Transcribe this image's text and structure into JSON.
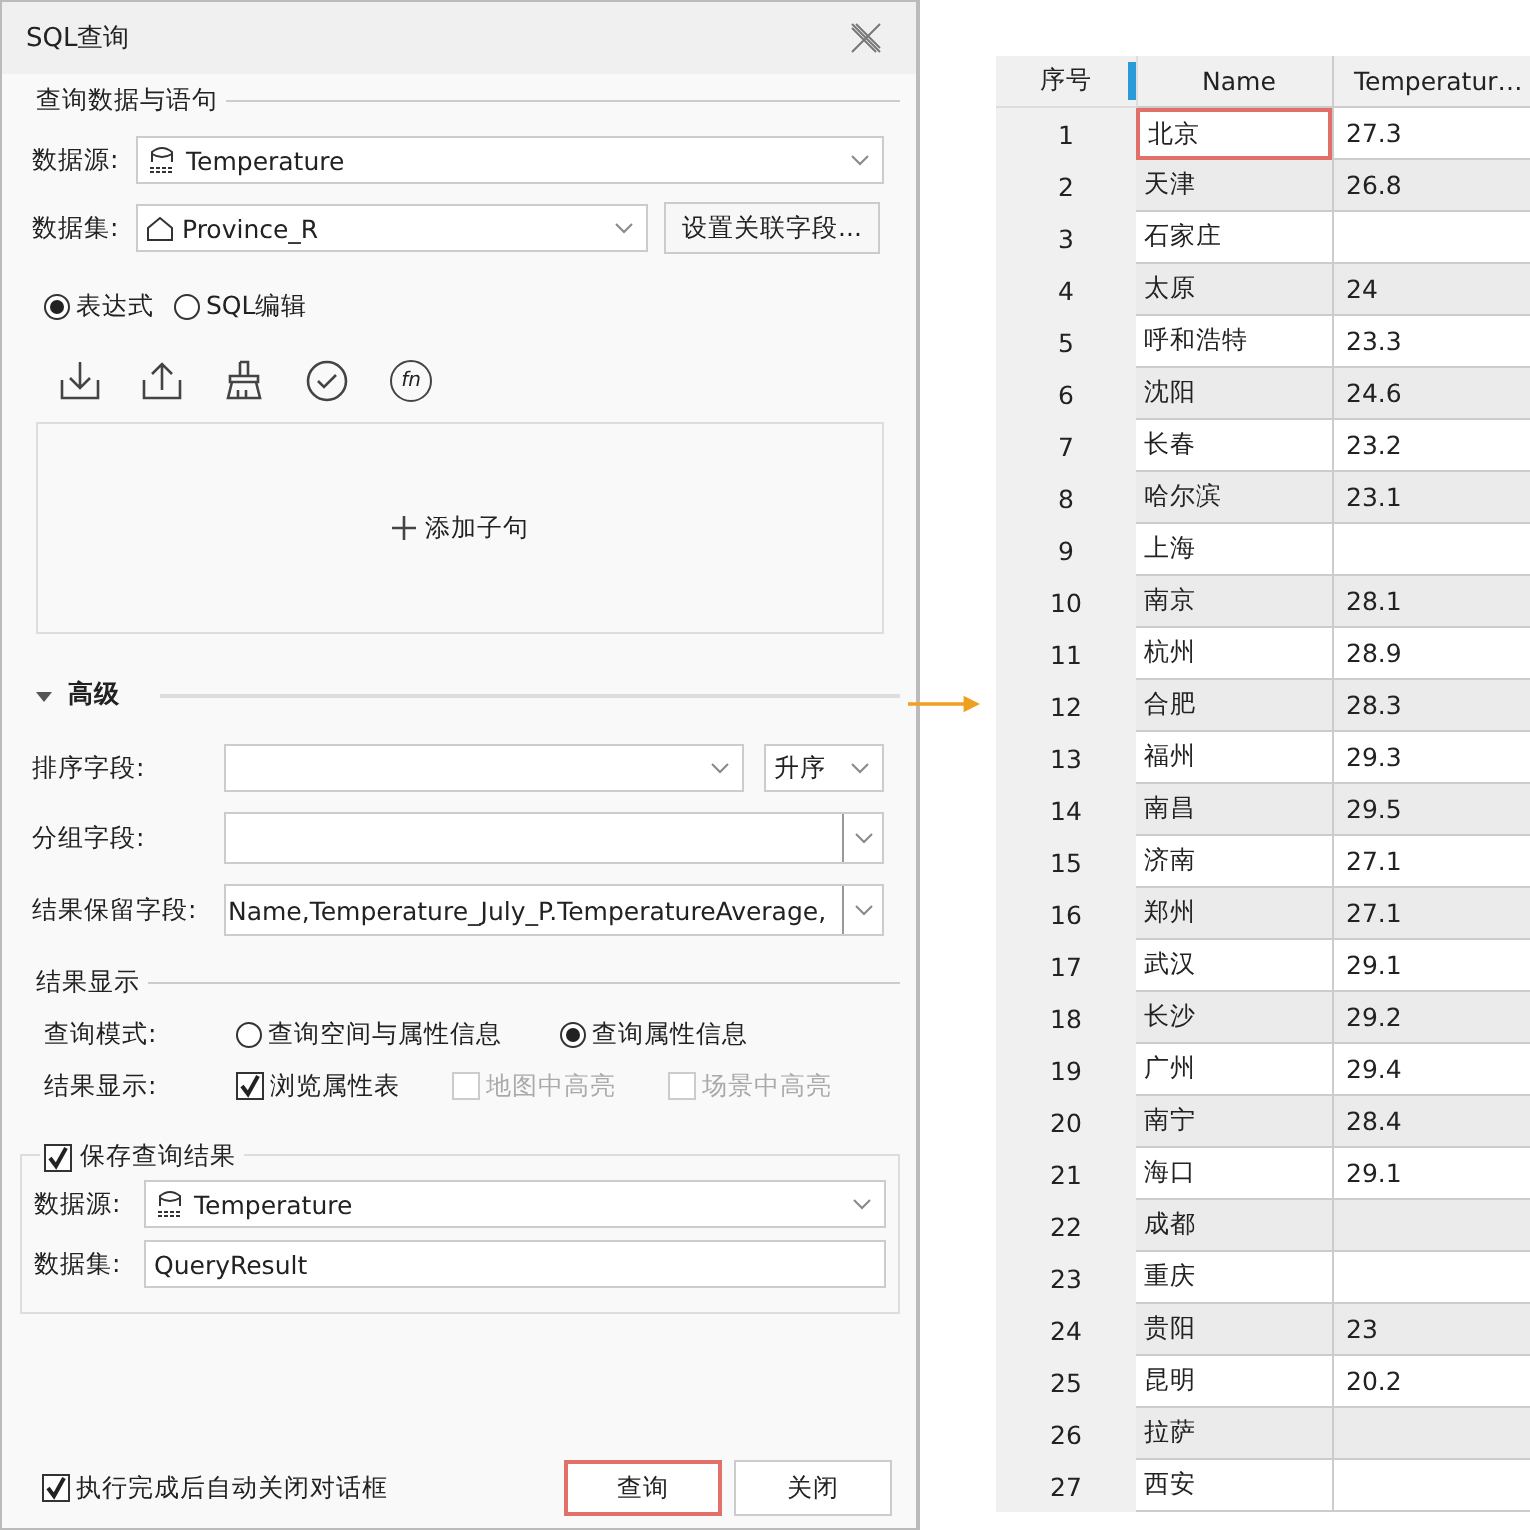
{
  "window": {
    "title": "SQL查询"
  },
  "query_section": {
    "title": "查询数据与语句",
    "datasource": {
      "label": "数据源:",
      "value": "Temperature"
    },
    "dataset": {
      "label": "数据集:",
      "value": "Province_R",
      "button": "设置关联字段..."
    },
    "modes": [
      {
        "label": "表达式",
        "selected": true
      },
      {
        "label": "SQL编辑",
        "selected": false
      }
    ],
    "toolbar": [
      {
        "kind": "import"
      },
      {
        "kind": "export"
      },
      {
        "kind": "clear"
      },
      {
        "kind": "validate"
      },
      {
        "kind": "function",
        "glyph": "fn"
      }
    ],
    "add_clause": "添加子句"
  },
  "advanced": {
    "title": "高级",
    "expanded": true,
    "sort_field": {
      "label": "排序字段:",
      "order": "升序"
    },
    "group_field": {
      "label": "分组字段:"
    },
    "retain_fields": {
      "label": "结果保留字段:",
      "value": "Name,Temperature_July_P.TemperatureAverage,"
    }
  },
  "result_display": {
    "title": "结果显示",
    "query_mode": {
      "label": "查询模式:",
      "options": [
        {
          "label": "查询空间与属性信息",
          "selected": false
        },
        {
          "label": "查询属性信息",
          "selected": true
        }
      ]
    },
    "display": {
      "label": "结果显示:",
      "options": [
        {
          "label": "浏览属性表",
          "checked": true,
          "disabled": false
        },
        {
          "label": "地图中高亮",
          "checked": false,
          "disabled": true
        },
        {
          "label": "场景中高亮",
          "checked": false,
          "disabled": true
        }
      ]
    }
  },
  "save_result": {
    "label": "保存查询结果",
    "checked": true,
    "datasource": {
      "label": "数据源:",
      "value": "Temperature"
    },
    "dataset": {
      "label": "数据集:",
      "value": "QueryResult"
    }
  },
  "auto_close": {
    "label": "执行完成后自动关闭对话框",
    "checked": true
  },
  "buttons": [
    {
      "label": "查询",
      "focused": true
    },
    {
      "label": "关闭",
      "focused": false
    }
  ],
  "table": {
    "columns": [
      "序号",
      "Name",
      "Temperatur…"
    ],
    "rows": [
      {
        "index": "1",
        "name": "北京",
        "value": "27.3",
        "selected": true
      },
      {
        "index": "2",
        "name": "天津",
        "value": "26.8",
        "selected": false
      },
      {
        "index": "3",
        "name": "石家庄",
        "selected": false
      },
      {
        "index": "4",
        "name": "太原",
        "value": "24",
        "selected": false
      },
      {
        "index": "5",
        "name": "呼和浩特",
        "value": "23.3",
        "selected": false
      },
      {
        "index": "6",
        "name": "沈阳",
        "value": "24.6",
        "selected": false
      },
      {
        "index": "7",
        "name": "长春",
        "value": "23.2",
        "selected": false
      },
      {
        "index": "8",
        "name": "哈尔滨",
        "value": "23.1",
        "selected": false
      },
      {
        "index": "9",
        "name": "上海",
        "selected": false
      },
      {
        "index": "10",
        "name": "南京",
        "value": "28.1",
        "selected": false
      },
      {
        "index": "11",
        "name": "杭州",
        "value": "28.9",
        "selected": false
      },
      {
        "index": "12",
        "name": "合肥",
        "value": "28.3",
        "selected": false
      },
      {
        "index": "13",
        "name": "福州",
        "value": "29.3",
        "selected": false
      },
      {
        "index": "14",
        "name": "南昌",
        "value": "29.5",
        "selected": false
      },
      {
        "index": "15",
        "name": "济南",
        "value": "27.1",
        "selected": false
      },
      {
        "index": "16",
        "name": "郑州",
        "value": "27.1",
        "selected": false
      },
      {
        "index": "17",
        "name": "武汉",
        "value": "29.1",
        "selected": false
      },
      {
        "index": "18",
        "name": "长沙",
        "value": "29.2",
        "selected": false
      },
      {
        "index": "19",
        "name": "广州",
        "value": "29.4",
        "selected": false
      },
      {
        "index": "20",
        "name": "南宁",
        "value": "28.4",
        "selected": false
      },
      {
        "index": "21",
        "name": "海口",
        "value": "29.1",
        "selected": false
      },
      {
        "index": "22",
        "name": "成都",
        "selected": false
      },
      {
        "index": "23",
        "name": "重庆",
        "selected": false
      },
      {
        "index": "24",
        "name": "贵阳",
        "value": "23",
        "selected": false
      },
      {
        "index": "25",
        "name": "昆明",
        "value": "20.2",
        "selected": false
      },
      {
        "index": "26",
        "name": "拉萨",
        "selected": false
      },
      {
        "index": "27",
        "name": "西安",
        "selected": false
      }
    ]
  }
}
